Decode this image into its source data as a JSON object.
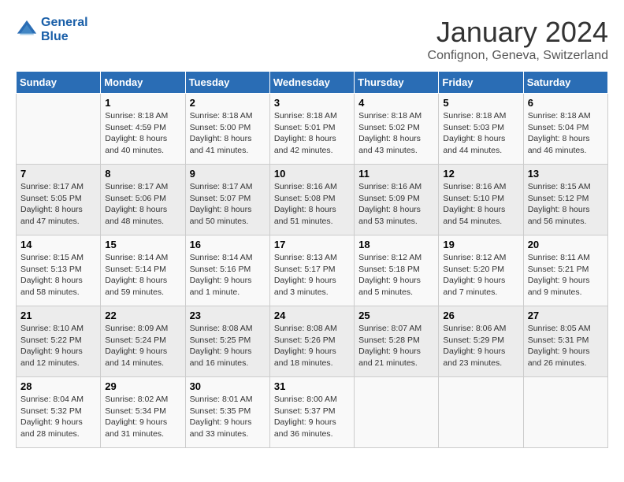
{
  "header": {
    "logo_line1": "General",
    "logo_line2": "Blue",
    "title": "January 2024",
    "subtitle": "Confignon, Geneva, Switzerland"
  },
  "columns": [
    "Sunday",
    "Monday",
    "Tuesday",
    "Wednesday",
    "Thursday",
    "Friday",
    "Saturday"
  ],
  "weeks": [
    [
      {
        "day": "",
        "info": ""
      },
      {
        "day": "1",
        "info": "Sunrise: 8:18 AM\nSunset: 4:59 PM\nDaylight: 8 hours\nand 40 minutes."
      },
      {
        "day": "2",
        "info": "Sunrise: 8:18 AM\nSunset: 5:00 PM\nDaylight: 8 hours\nand 41 minutes."
      },
      {
        "day": "3",
        "info": "Sunrise: 8:18 AM\nSunset: 5:01 PM\nDaylight: 8 hours\nand 42 minutes."
      },
      {
        "day": "4",
        "info": "Sunrise: 8:18 AM\nSunset: 5:02 PM\nDaylight: 8 hours\nand 43 minutes."
      },
      {
        "day": "5",
        "info": "Sunrise: 8:18 AM\nSunset: 5:03 PM\nDaylight: 8 hours\nand 44 minutes."
      },
      {
        "day": "6",
        "info": "Sunrise: 8:18 AM\nSunset: 5:04 PM\nDaylight: 8 hours\nand 46 minutes."
      }
    ],
    [
      {
        "day": "7",
        "info": "Sunrise: 8:17 AM\nSunset: 5:05 PM\nDaylight: 8 hours\nand 47 minutes."
      },
      {
        "day": "8",
        "info": "Sunrise: 8:17 AM\nSunset: 5:06 PM\nDaylight: 8 hours\nand 48 minutes."
      },
      {
        "day": "9",
        "info": "Sunrise: 8:17 AM\nSunset: 5:07 PM\nDaylight: 8 hours\nand 50 minutes."
      },
      {
        "day": "10",
        "info": "Sunrise: 8:16 AM\nSunset: 5:08 PM\nDaylight: 8 hours\nand 51 minutes."
      },
      {
        "day": "11",
        "info": "Sunrise: 8:16 AM\nSunset: 5:09 PM\nDaylight: 8 hours\nand 53 minutes."
      },
      {
        "day": "12",
        "info": "Sunrise: 8:16 AM\nSunset: 5:10 PM\nDaylight: 8 hours\nand 54 minutes."
      },
      {
        "day": "13",
        "info": "Sunrise: 8:15 AM\nSunset: 5:12 PM\nDaylight: 8 hours\nand 56 minutes."
      }
    ],
    [
      {
        "day": "14",
        "info": "Sunrise: 8:15 AM\nSunset: 5:13 PM\nDaylight: 8 hours\nand 58 minutes."
      },
      {
        "day": "15",
        "info": "Sunrise: 8:14 AM\nSunset: 5:14 PM\nDaylight: 8 hours\nand 59 minutes."
      },
      {
        "day": "16",
        "info": "Sunrise: 8:14 AM\nSunset: 5:16 PM\nDaylight: 9 hours\nand 1 minute."
      },
      {
        "day": "17",
        "info": "Sunrise: 8:13 AM\nSunset: 5:17 PM\nDaylight: 9 hours\nand 3 minutes."
      },
      {
        "day": "18",
        "info": "Sunrise: 8:12 AM\nSunset: 5:18 PM\nDaylight: 9 hours\nand 5 minutes."
      },
      {
        "day": "19",
        "info": "Sunrise: 8:12 AM\nSunset: 5:20 PM\nDaylight: 9 hours\nand 7 minutes."
      },
      {
        "day": "20",
        "info": "Sunrise: 8:11 AM\nSunset: 5:21 PM\nDaylight: 9 hours\nand 9 minutes."
      }
    ],
    [
      {
        "day": "21",
        "info": "Sunrise: 8:10 AM\nSunset: 5:22 PM\nDaylight: 9 hours\nand 12 minutes."
      },
      {
        "day": "22",
        "info": "Sunrise: 8:09 AM\nSunset: 5:24 PM\nDaylight: 9 hours\nand 14 minutes."
      },
      {
        "day": "23",
        "info": "Sunrise: 8:08 AM\nSunset: 5:25 PM\nDaylight: 9 hours\nand 16 minutes."
      },
      {
        "day": "24",
        "info": "Sunrise: 8:08 AM\nSunset: 5:26 PM\nDaylight: 9 hours\nand 18 minutes."
      },
      {
        "day": "25",
        "info": "Sunrise: 8:07 AM\nSunset: 5:28 PM\nDaylight: 9 hours\nand 21 minutes."
      },
      {
        "day": "26",
        "info": "Sunrise: 8:06 AM\nSunset: 5:29 PM\nDaylight: 9 hours\nand 23 minutes."
      },
      {
        "day": "27",
        "info": "Sunrise: 8:05 AM\nSunset: 5:31 PM\nDaylight: 9 hours\nand 26 minutes."
      }
    ],
    [
      {
        "day": "28",
        "info": "Sunrise: 8:04 AM\nSunset: 5:32 PM\nDaylight: 9 hours\nand 28 minutes."
      },
      {
        "day": "29",
        "info": "Sunrise: 8:02 AM\nSunset: 5:34 PM\nDaylight: 9 hours\nand 31 minutes."
      },
      {
        "day": "30",
        "info": "Sunrise: 8:01 AM\nSunset: 5:35 PM\nDaylight: 9 hours\nand 33 minutes."
      },
      {
        "day": "31",
        "info": "Sunrise: 8:00 AM\nSunset: 5:37 PM\nDaylight: 9 hours\nand 36 minutes."
      },
      {
        "day": "",
        "info": ""
      },
      {
        "day": "",
        "info": ""
      },
      {
        "day": "",
        "info": ""
      }
    ]
  ]
}
